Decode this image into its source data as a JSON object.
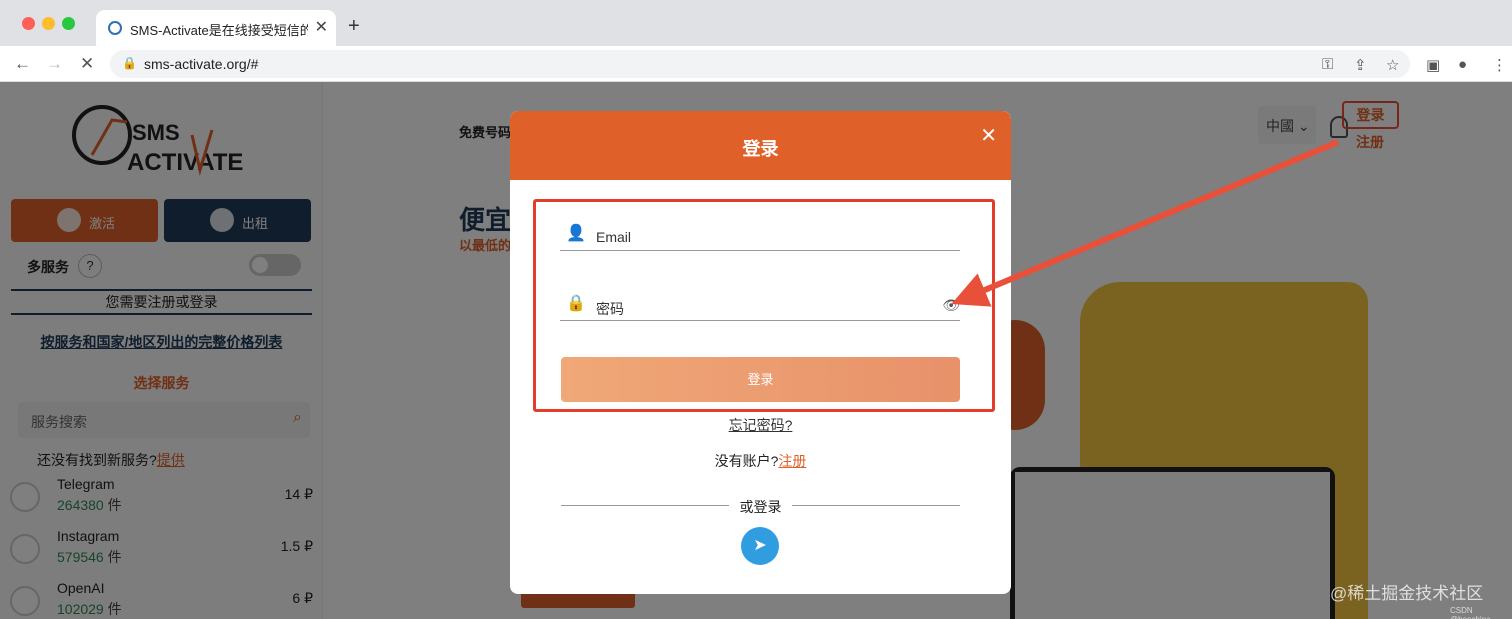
{
  "browser": {
    "tab_title": "SMS-Activate是在线接受短信的",
    "tab_close": "✕",
    "new_tab": "+",
    "url": "sms-activate.org/#"
  },
  "sidebar": {
    "activate_label": "激活",
    "rent_label": "出租",
    "multi_service": "多服务",
    "help": "?",
    "need_login": "您需要注册或登录",
    "price_list_link": "按服务和国家/地区列出的完整价格列表",
    "choose_service": "选择服务",
    "search_placeholder": "服务搜索",
    "not_found_text": "还没有找到新服务?",
    "not_found_link": "提供",
    "services": [
      {
        "name": "Telegram",
        "count": "264380",
        "unit": "件",
        "price": "14 ₽"
      },
      {
        "name": "Instagram",
        "count": "579546",
        "unit": "件",
        "price": "1.5 ₽"
      },
      {
        "name": "OpenAI",
        "count": "102029",
        "unit": "件",
        "price": "6 ₽"
      }
    ]
  },
  "header": {
    "free_numbers": "免费号码",
    "language": "中國",
    "login": "登录",
    "register": "注册"
  },
  "hero": {
    "title": "便宜",
    "subtitle": "以最低的"
  },
  "modal": {
    "title": "登录",
    "close": "✕",
    "email_label": "Email",
    "password_label": "密码",
    "login_button": "登录",
    "forgot": "忘记密码?",
    "no_account": "没有账户?",
    "register_link": "注册",
    "or_login": "或登录"
  },
  "watermark": "@稀土掘金技术社区",
  "watermark_small": "CSDN @boechina",
  "colors": {
    "accent": "#e0602a",
    "navy": "#1f3a5a",
    "annotation_red": "#e53b2c"
  }
}
